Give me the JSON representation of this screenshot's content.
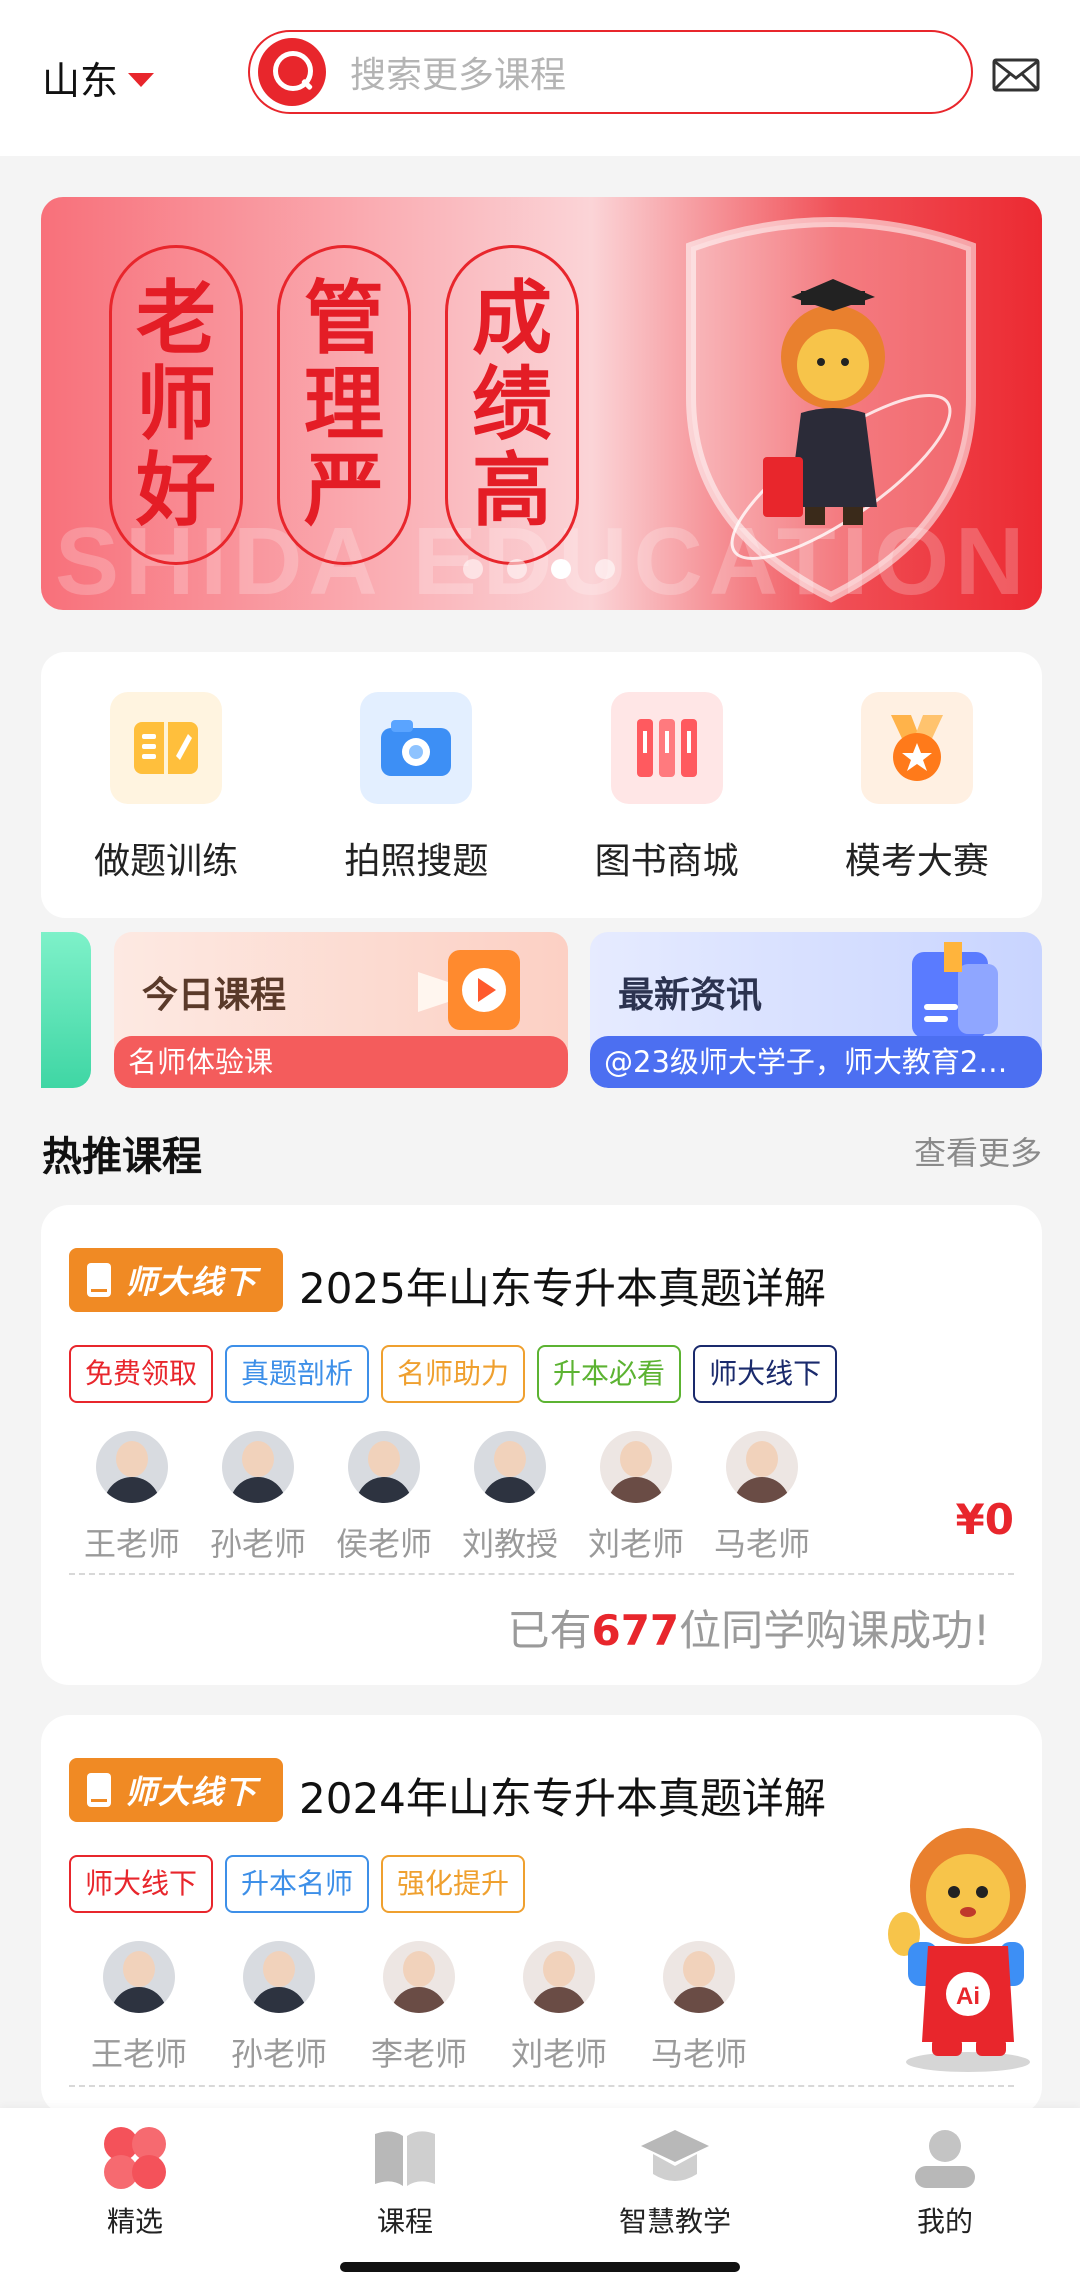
{
  "header": {
    "city": "山东",
    "search_placeholder": "搜索更多课程"
  },
  "banner": {
    "slogans": [
      [
        "老",
        "师",
        "好"
      ],
      [
        "管",
        "理",
        "严"
      ],
      [
        "成",
        "绩",
        "高"
      ]
    ],
    "watermark": "SHIDA EDUCATION",
    "dot_count": 4,
    "active_dot": 3
  },
  "quick_menu": [
    {
      "label": "做题训练",
      "icon": "notebook-icon"
    },
    {
      "label": "拍照搜题",
      "icon": "camera-icon"
    },
    {
      "label": "图书商城",
      "icon": "books-icon"
    },
    {
      "label": "模考大赛",
      "icon": "medal-icon"
    }
  ],
  "promos": [
    {
      "title": "今日课程",
      "subtitle": "名师体验课",
      "icon": "play-icon"
    },
    {
      "title": "最新资讯",
      "subtitle": "@23级师大学子，师大教育2…",
      "icon": "news-icon"
    }
  ],
  "section": {
    "title": "热推课程",
    "more": "查看更多"
  },
  "courses": [
    {
      "badge": "师大线下",
      "title": "2025年山东专升本真题详解",
      "tags": [
        {
          "text": "免费领取",
          "color": "#e8262c"
        },
        {
          "text": "真题剖析",
          "color": "#3d8fe8"
        },
        {
          "text": "名师助力",
          "color": "#efa02f"
        },
        {
          "text": "升本必看",
          "color": "#5cb332"
        },
        {
          "text": "师大线下",
          "color": "#1a2a6c"
        }
      ],
      "teachers": [
        "王老师",
        "孙老师",
        "侯老师",
        "刘教授",
        "刘老师",
        "马老师"
      ],
      "price": "¥0",
      "purchase_prefix": "已有",
      "purchase_count": "677",
      "purchase_suffix": "位同学购课成功!"
    },
    {
      "badge": "师大线下",
      "title": "2024年山东专升本真题详解",
      "tags": [
        {
          "text": "师大线下",
          "color": "#e8262c"
        },
        {
          "text": "升本名师",
          "color": "#3d8fe8"
        },
        {
          "text": "强化提升",
          "color": "#efa02f"
        }
      ],
      "teachers": [
        "王老师",
        "孙老师",
        "李老师",
        "刘老师",
        "马老师"
      ]
    }
  ],
  "bottom_nav": [
    {
      "label": "精选",
      "icon": "clover-icon",
      "active": true
    },
    {
      "label": "课程",
      "icon": "book-icon",
      "active": false
    },
    {
      "label": "智慧教学",
      "icon": "graduation-cap-icon",
      "active": false
    },
    {
      "label": "我的",
      "icon": "profile-icon",
      "active": false
    }
  ],
  "colors": {
    "brand_red": "#e8262c",
    "badge_orange": "#f08a24",
    "background": "#f4f4f4"
  }
}
